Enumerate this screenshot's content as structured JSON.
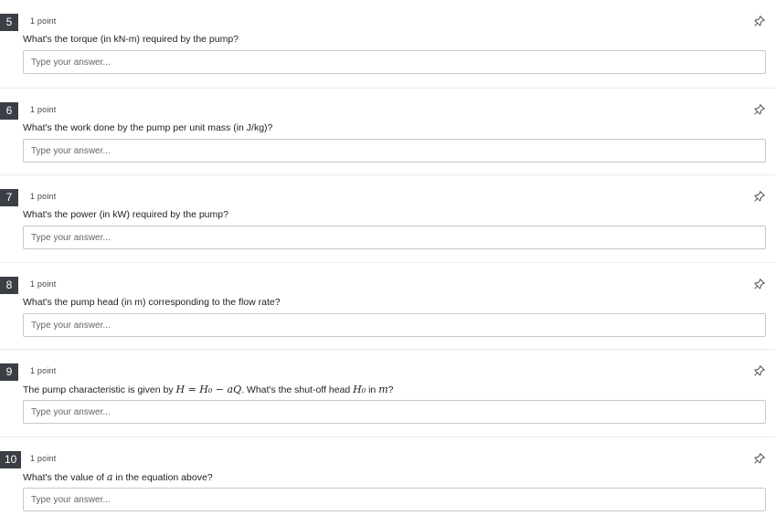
{
  "questions": [
    {
      "number": "5",
      "points": "1 point",
      "text": "What's the torque (in kN-m) required by the pump?",
      "placeholder": "Type your answer..."
    },
    {
      "number": "6",
      "points": "1 point",
      "text": "What's the work done by the pump per unit mass (in J/kg)?",
      "placeholder": "Type your answer..."
    },
    {
      "number": "7",
      "points": "1 point",
      "text": "What's the power (in kW) required by the pump?",
      "placeholder": "Type your answer..."
    },
    {
      "number": "8",
      "points": "1 point",
      "text": "What's the pump head (in m) corresponding to the flow rate?",
      "placeholder": "Type your answer..."
    },
    {
      "number": "9",
      "points": "1 point",
      "text_pre": "The pump characteristic is given by ",
      "equation": "H = H₀ − aQ",
      "text_mid": ". What's the shut-off head ",
      "var": "H₀",
      "text_in": " in ",
      "unit": "m",
      "text_post": "?",
      "placeholder": "Type your answer..."
    },
    {
      "number": "10",
      "points": "1 point",
      "text_pre": "What's the value of ",
      "var": "a",
      "text_post": " in the equation above?",
      "placeholder": "Type your answer..."
    }
  ],
  "icons": {
    "pin": "pin-icon"
  },
  "colors": {
    "badge_bg": "#3b3f45",
    "border": "#c8c8c8"
  }
}
